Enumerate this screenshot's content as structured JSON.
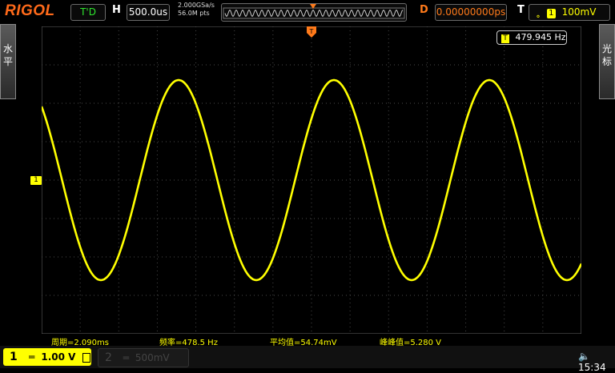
{
  "topbar": {
    "brand": "RIGOL",
    "run_status": "T'D",
    "horizontal_label": "H",
    "timebase": "500.0us",
    "sample_rate": "2.000GSa/s",
    "memory_depth": "56.0M pts",
    "delay_label": "D",
    "delay_value": "0.00000000ps",
    "trigger_label": "T",
    "trigger_channel": "1",
    "trigger_level": "100mV"
  },
  "side_tabs": {
    "left": [
      "水",
      "平"
    ],
    "right": [
      "光",
      "标"
    ]
  },
  "frequency_counter": "479.945 Hz",
  "channel_marker": "1",
  "measurements": {
    "period": "周期=2.090ms",
    "frequency": "频率=478.5 Hz",
    "mean": "平均值=54.74mV",
    "peak_to_peak": "峰峰值=5.280 V"
  },
  "bottombar": {
    "ch1_number": "1",
    "ch1_scale": "1.00 V",
    "ch2_number": "2",
    "ch2_scale": "500mV",
    "clock": "15:34"
  },
  "colors": {
    "trace": "#ffff00",
    "brand": "#ff6a1a",
    "grid": "#555555"
  },
  "waveform": {
    "shape": "sine",
    "frequency_hz": 478.5,
    "peak_to_peak_v": 5.28
  }
}
